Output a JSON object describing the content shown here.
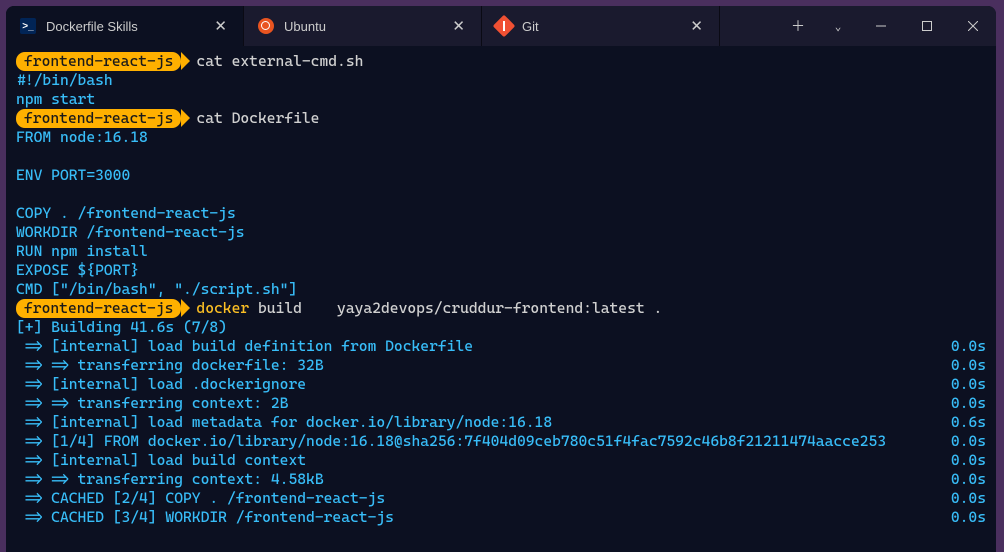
{
  "tabs": [
    {
      "label": "Dockerfile Skills",
      "active": true
    },
    {
      "label": "Ubuntu",
      "active": false
    },
    {
      "label": "Git",
      "active": false
    }
  ],
  "prompt_label": "frontend-react-js",
  "lines": {
    "cmd1": "cat external-cmd.sh",
    "shebang": "#!/bin/bash",
    "npmstart": "npm start",
    "cmd2": "cat Dockerfile",
    "from": "FROM node:16.18",
    "env": "ENV PORT=3000",
    "copy": "COPY . /frontend-react-js",
    "workdir": "WORKDIR /frontend-react-js",
    "run": "RUN npm install",
    "expose": "EXPOSE ${PORT}",
    "cmd": "CMD [\"/bin/bash\", \"./script.sh\"]",
    "cmd3_a": "docker ",
    "cmd3_b": "build    yaya2devops/cruddur-frontend:latest .",
    "building": "[+] Building 41.6s (7/8)"
  },
  "build_output": [
    {
      "left": " => [internal] load build definition from Dockerfile",
      "right": "0.0s"
    },
    {
      "left": " => => transferring dockerfile: 32B",
      "right": "0.0s"
    },
    {
      "left": " => [internal] load .dockerignore",
      "right": "0.0s"
    },
    {
      "left": " => => transferring context: 2B",
      "right": "0.0s"
    },
    {
      "left": " => [internal] load metadata for docker.io/library/node:16.18",
      "right": "0.6s"
    },
    {
      "left": " => [1/4] FROM docker.io/library/node:16.18@sha256:7f404d09ceb780c51f4fac7592c46b8f21211474aacce253",
      "right": "0.0s"
    },
    {
      "left": " => [internal] load build context",
      "right": "0.0s"
    },
    {
      "left": " => => transferring context: 4.58kB",
      "right": "0.0s"
    },
    {
      "left": " => CACHED [2/4] COPY . /frontend-react-js",
      "right": "0.0s"
    },
    {
      "left": " => CACHED [3/4] WORKDIR /frontend-react-js",
      "right": "0.0s"
    }
  ]
}
